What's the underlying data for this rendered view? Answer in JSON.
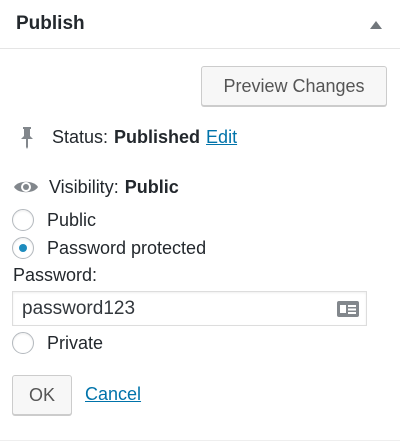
{
  "header": {
    "title": "Publish"
  },
  "actions": {
    "preview_label": "Preview Changes"
  },
  "status": {
    "label": "Status:",
    "value": "Published",
    "edit_label": "Edit"
  },
  "visibility": {
    "label": "Visibility:",
    "value": "Public",
    "options": [
      {
        "label": "Public",
        "selected": false
      },
      {
        "label": "Password protected",
        "selected": true
      },
      {
        "label": "Private",
        "selected": false
      }
    ],
    "password_label": "Password:",
    "password_value": "password123",
    "ok_label": "OK",
    "cancel_label": "Cancel"
  },
  "colors": {
    "link": "#0073aa",
    "radio_selected": "#1e8cbe",
    "text": "#23282d"
  },
  "icons": {
    "status": "pin-icon",
    "visibility": "eye-icon",
    "password_field": "contact-card-icon",
    "toggle": "arrow-up-icon"
  }
}
